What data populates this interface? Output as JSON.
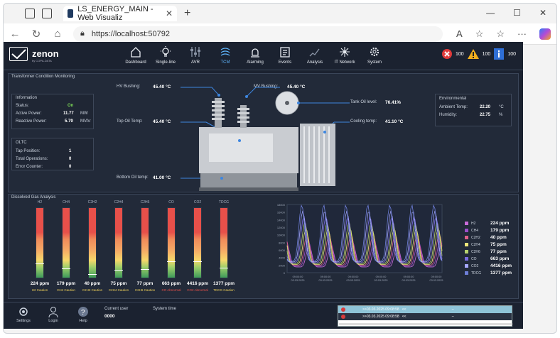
{
  "browser": {
    "tab_title": "LS_ENERGY_MAIN - Web Visualiz",
    "url": "https://localhost:50792"
  },
  "app": {
    "brand": "zenon",
    "brand_sub": "by COPA-DATA",
    "menu": [
      {
        "label": "Dashboard",
        "icon": "home-icon"
      },
      {
        "label": "Single-line",
        "icon": "bulb-icon"
      },
      {
        "label": "AVR",
        "icon": "sliders-icon"
      },
      {
        "label": "TCM",
        "icon": "transformer-icon"
      },
      {
        "label": "Alarming",
        "icon": "siren-icon"
      },
      {
        "label": "Events",
        "icon": "events-icon"
      },
      {
        "label": "Analysis",
        "icon": "analysis-icon"
      },
      {
        "label": "IT Network",
        "icon": "network-icon"
      },
      {
        "label": "System",
        "icon": "gear-icon"
      }
    ],
    "alarm_counts": {
      "error": "100",
      "warning": "100",
      "info": "100"
    },
    "colors": {
      "active": "#5fb7ff",
      "bg": "#1b2230",
      "panel": "#222a39"
    }
  },
  "tcm": {
    "title": "Transformer Condition Monitoring",
    "information": {
      "title": "Information",
      "status_label": "Status:",
      "status_value": "On",
      "active_power_label": "Active Power:",
      "active_power_value": "11.77",
      "active_power_unit": "MW",
      "reactive_power_label": "Reactive Power:",
      "reactive_power_value": "5.79",
      "reactive_power_unit": "MVAr"
    },
    "oltc": {
      "title": "OLTC",
      "tap_label": "Tap Position:",
      "tap_value": "1",
      "ops_label": "Total Operations:",
      "ops_value": "0",
      "err_label": "Error Counter:",
      "err_value": "0"
    },
    "sensors": {
      "hv_label": "HV Bushing:",
      "hv_value": "45.40 °C",
      "mv_label": "MV Bushing:",
      "mv_value": "45.40 °C",
      "top_oil_label": "Top Oil Temp:",
      "top_oil_value": "45.40 °C",
      "bottom_oil_label": "Bottom Oil temp:",
      "bottom_oil_value": "41.00 °C",
      "tank_label": "Tank Oil level:",
      "tank_value": "76.41%",
      "cooling_label": "Cooling temp:",
      "cooling_value": "41.10 °C"
    },
    "environmental": {
      "title": "Environmental",
      "temp_label": "Ambient Temp:",
      "temp_value": "22.20",
      "temp_unit": "°C",
      "hum_label": "Humidity:",
      "hum_value": "22.75",
      "hum_unit": "%"
    }
  },
  "dga": {
    "title": "Dissolved Gas Analysis",
    "gases": [
      {
        "name": "H2",
        "value": "224 ppm",
        "status": "H2 Caution",
        "level": "caution"
      },
      {
        "name": "CH4",
        "value": "179 ppm",
        "status": "CH4 Caution",
        "level": "caution"
      },
      {
        "name": "C2H2",
        "value": "40 ppm",
        "status": "C2H2 Caution",
        "level": "caution"
      },
      {
        "name": "C2H4",
        "value": "75 ppm",
        "status": "C2H4 Caution",
        "level": "caution"
      },
      {
        "name": "C2H6",
        "value": "77 ppm",
        "status": "C2H6 Caution",
        "level": "caution"
      },
      {
        "name": "CO",
        "value": "663 ppm",
        "status": "CO Abnormal",
        "level": "abnormal"
      },
      {
        "name": "CO2",
        "value": "4416 ppm",
        "status": "CO2 Abnormal",
        "level": "abnormal"
      },
      {
        "name": "TDCG",
        "value": "1377 ppm",
        "status": "TDCG Caution",
        "level": "caution"
      }
    ],
    "fill_fraction": [
      0.22,
      0.15,
      0.07,
      0.13,
      0.14,
      0.25,
      0.25,
      0.16
    ],
    "chart_y_ticks": [
      "18000",
      "16000",
      "14000",
      "12000",
      "10000",
      "8000",
      "6000",
      "4000",
      "2000",
      "0"
    ],
    "chart_x_ticks": [
      "09:00:00\n03.03.2025",
      "09:00:00\n03.03.2025",
      "09:00:00\n03.03.2025",
      "09:00:00\n03.03.2025",
      "09:00:00\n03.03.2025",
      "09:00:00\n03.03.2025"
    ],
    "legend": [
      {
        "name": "H2",
        "value": "224 ppm",
        "color": "#c86bd8"
      },
      {
        "name": "CH4",
        "value": "179 ppm",
        "color": "#9b4fc9"
      },
      {
        "name": "C2H2",
        "value": "40 ppm",
        "color": "#e0608a"
      },
      {
        "name": "C2H4",
        "value": "75 ppm",
        "color": "#f0e87a"
      },
      {
        "name": "C2H6",
        "value": "77 ppm",
        "color": "#b6d26e"
      },
      {
        "name": "CO",
        "value": "663 ppm",
        "color": "#7a6ce0"
      },
      {
        "name": "CO2",
        "value": "4416 ppm",
        "color": "#a7a9ff"
      },
      {
        "name": "TDCG",
        "value": "1377 ppm",
        "color": "#6e7fd8"
      }
    ]
  },
  "footer": {
    "settings": "Settings",
    "login": "Login",
    "help": "Help",
    "current_user_label": "Current user",
    "current_user_value": "0000",
    "system_time_label": "System time",
    "alarms": [
      {
        "time": ">>03.03.2025 09:08:58",
        "flag": "<<",
        "extra": "--"
      },
      {
        "time": ">>03.03.2025 09:08:58",
        "flag": "<<",
        "extra": "--"
      }
    ]
  }
}
